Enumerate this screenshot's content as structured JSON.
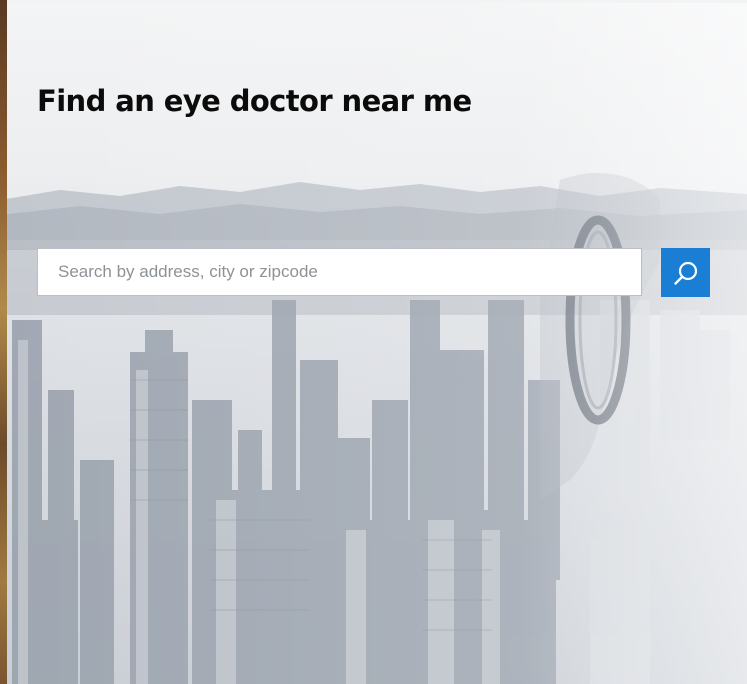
{
  "page": {
    "title": "Find an eye doctor near me"
  },
  "search": {
    "placeholder": "Search by address, city or zipcode",
    "value": "",
    "button_icon": "search-icon"
  },
  "colors": {
    "accent": "#1a7fd4",
    "title_text": "#0b0b0b",
    "placeholder_text": "#8d9297"
  }
}
